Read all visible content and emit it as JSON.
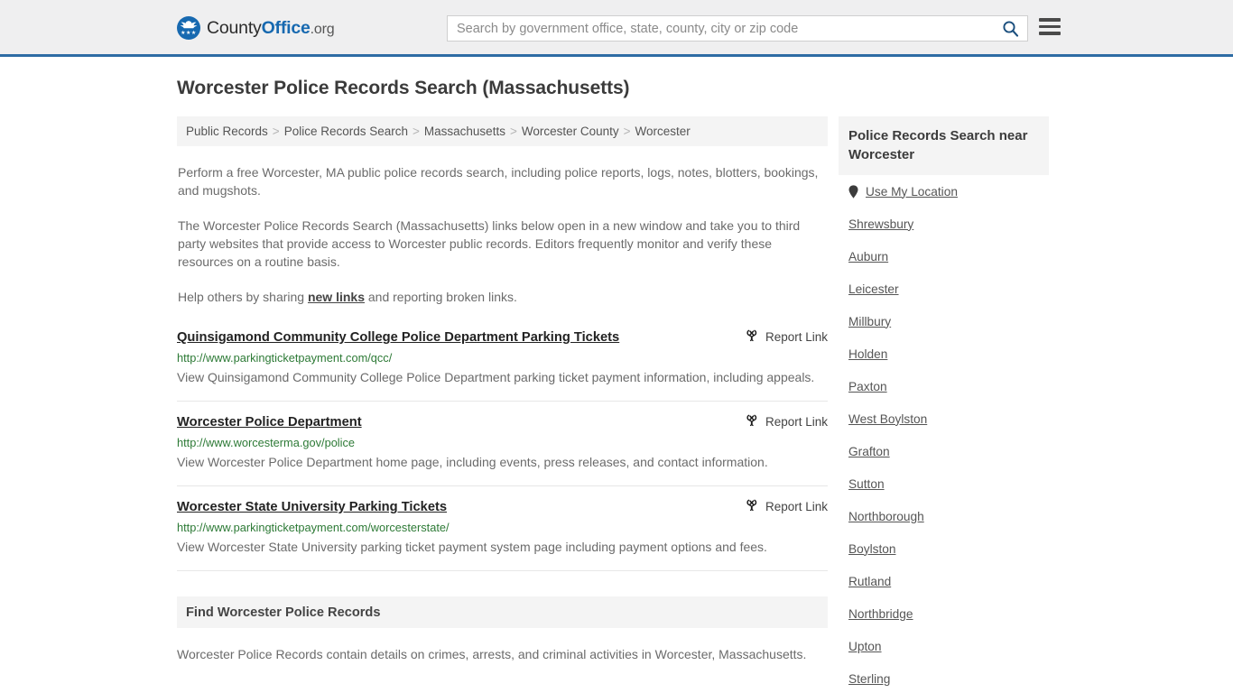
{
  "header": {
    "brand": {
      "part1": "County",
      "part2": "Office",
      "part3": ".org",
      "stars": "★★★"
    },
    "search": {
      "value": "",
      "placeholder": "Search by government office, state, county, city or zip code"
    },
    "icons": {
      "search": "search-icon",
      "menu": "hamburger-menu-icon"
    }
  },
  "page": {
    "title": "Worcester Police Records Search (Massachusetts)"
  },
  "breadcrumb": {
    "separator": ">",
    "items": [
      {
        "label": "Public Records"
      },
      {
        "label": "Police Records Search"
      },
      {
        "label": "Massachusetts"
      },
      {
        "label": "Worcester County"
      },
      {
        "label": "Worcester"
      }
    ]
  },
  "intro": {
    "p1": "Perform a free Worcester, MA public police records search, including police reports, logs, notes, blotters, bookings, and mugshots.",
    "p2": "The Worcester Police Records Search (Massachusetts) links below open in a new window and take you to third party websites that provide access to Worcester public records. Editors frequently monitor and verify these resources on a routine basis.",
    "p3_before": "Help others by sharing ",
    "p3_link": "new links",
    "p3_after": " and reporting broken links."
  },
  "report_link_label": "Report Link",
  "links": [
    {
      "title": "Quinsigamond Community College Police Department Parking Tickets",
      "url": "http://www.parkingticketpayment.com/qcc/",
      "description": "View Quinsigamond Community College Police Department parking ticket payment information, including appeals."
    },
    {
      "title": "Worcester Police Department",
      "url": "http://www.worcesterma.gov/police",
      "description": "View Worcester Police Department home page, including events, press releases, and contact information."
    },
    {
      "title": "Worcester State University Parking Tickets",
      "url": "http://www.parkingticketpayment.com/worcesterstate/",
      "description": "View Worcester State University parking ticket payment system page including payment options and fees."
    }
  ],
  "find_section": {
    "heading": "Find Worcester Police Records",
    "body": "Worcester Police Records contain details on crimes, arrests, and criminal activities in Worcester, Massachusetts."
  },
  "sidebar": {
    "heading": "Police Records Search near Worcester",
    "use_my_location": "Use My Location",
    "cities": [
      {
        "label": "Shrewsbury"
      },
      {
        "label": "Auburn"
      },
      {
        "label": "Leicester"
      },
      {
        "label": "Millbury"
      },
      {
        "label": "Holden"
      },
      {
        "label": "Paxton"
      },
      {
        "label": "West Boylston"
      },
      {
        "label": "Grafton"
      },
      {
        "label": "Sutton"
      },
      {
        "label": "Northborough"
      },
      {
        "label": "Boylston"
      },
      {
        "label": "Rutland"
      },
      {
        "label": "Northbridge"
      },
      {
        "label": "Upton"
      },
      {
        "label": "Sterling"
      }
    ]
  },
  "colors": {
    "header_bg": "#efeff0",
    "header_border": "#2e6ca4",
    "brand_blue": "#1769b0",
    "panel_gray": "#f4f4f4",
    "url_green": "#2d7a36",
    "body_text": "#6b6b6b"
  }
}
